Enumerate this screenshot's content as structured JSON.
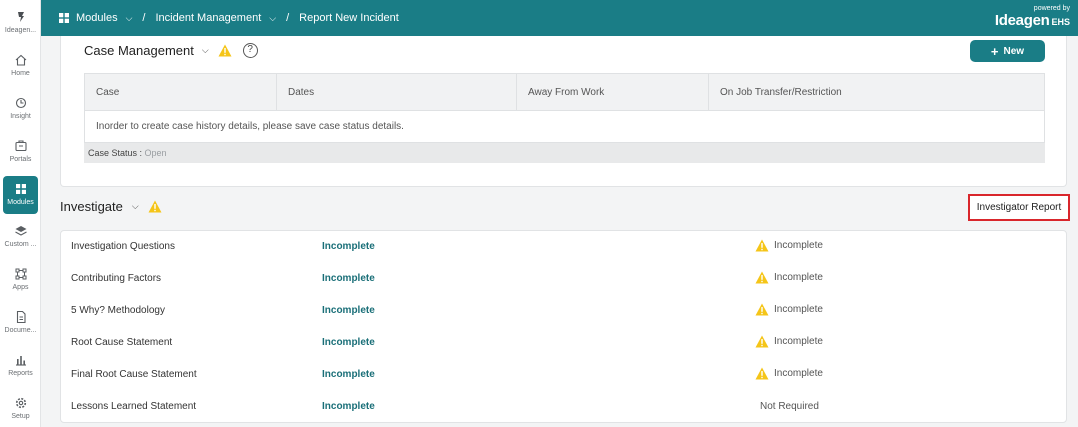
{
  "sidebar": {
    "items": [
      {
        "label": "Ideagen...",
        "icon": "ideagen-logo-icon"
      },
      {
        "label": "Home",
        "icon": "home-icon"
      },
      {
        "label": "Insight",
        "icon": "insight-icon"
      },
      {
        "label": "Portals",
        "icon": "portals-icon"
      },
      {
        "label": "Modules",
        "icon": "modules-icon",
        "active": true
      },
      {
        "label": "Custom ...",
        "icon": "custom-layers-icon"
      },
      {
        "label": "Apps",
        "icon": "apps-icon"
      },
      {
        "label": "Docume...",
        "icon": "document-icon"
      },
      {
        "label": "Reports",
        "icon": "reports-icon"
      },
      {
        "label": "Setup",
        "icon": "gear-icon"
      }
    ]
  },
  "header": {
    "breadcrumb": [
      "Modules",
      "Incident Management",
      "Report New Incident"
    ],
    "powered_by": "powered by",
    "brand_name": "Ideagen",
    "brand_suffix": "EHS"
  },
  "case_management": {
    "title": "Case Management",
    "help_symbol": "?",
    "new_button": "New",
    "columns": [
      "Case",
      "Dates",
      "Away From Work",
      "On Job Transfer/Restriction"
    ],
    "message": "Inorder to create case history details, please save case status details.",
    "status_label": "Case Status :",
    "status_value": "Open"
  },
  "investigate": {
    "title": "Investigate",
    "report_button": "Investigator Report",
    "rows": [
      {
        "name": "Investigation Questions",
        "status": "Incomplete",
        "result": "Incomplete",
        "warning": true
      },
      {
        "name": "Contributing Factors",
        "status": "Incomplete",
        "result": "Incomplete",
        "warning": true
      },
      {
        "name": "5 Why? Methodology",
        "status": "Incomplete",
        "result": "Incomplete",
        "warning": true
      },
      {
        "name": "Root Cause Statement",
        "status": "Incomplete",
        "result": "Incomplete",
        "warning": true
      },
      {
        "name": "Final Root Cause Statement",
        "status": "Incomplete",
        "result": "Incomplete",
        "warning": true
      },
      {
        "name": "Lessons Learned Statement",
        "status": "Incomplete",
        "result": "Not Required",
        "warning": false
      }
    ]
  },
  "colors": {
    "brand_teal": "#1a7d86",
    "warning_yellow": "#f5c518",
    "highlight_red": "#d9262c"
  }
}
